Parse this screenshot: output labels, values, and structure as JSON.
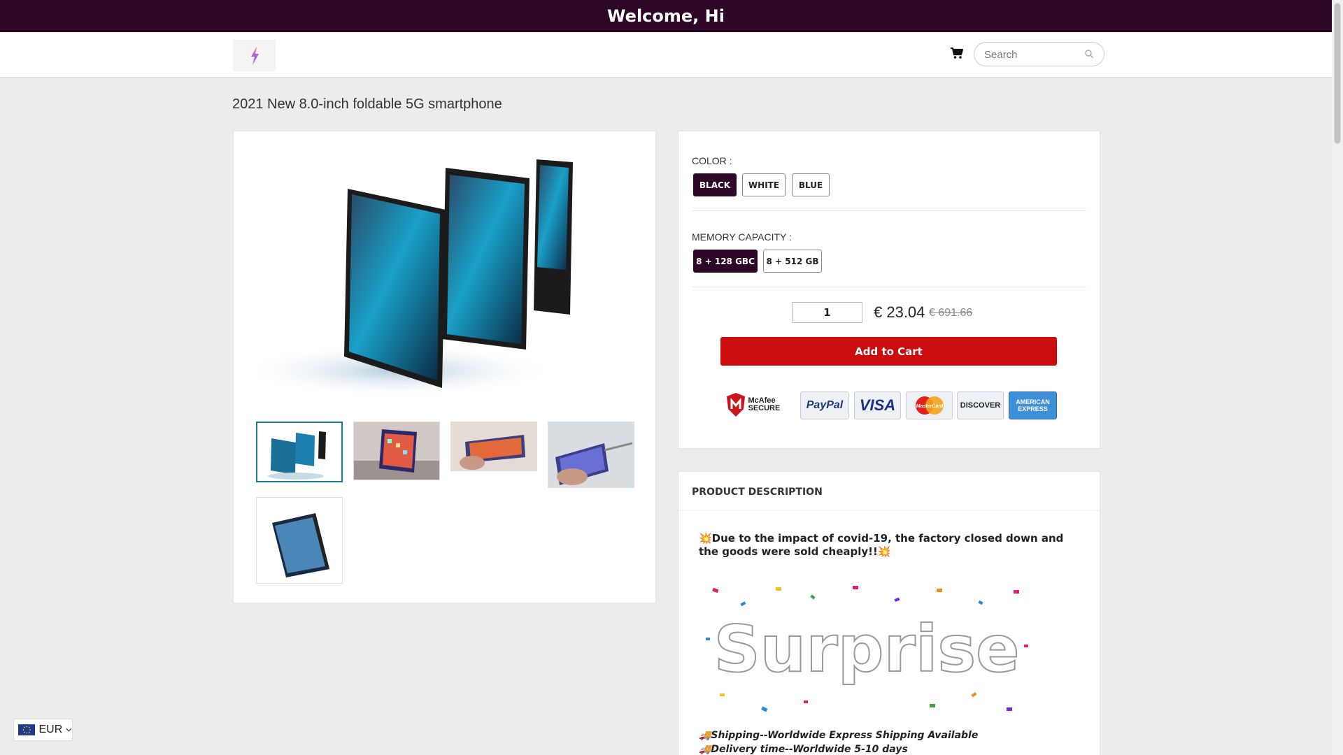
{
  "topbar": {
    "welcome": "Welcome, Hi"
  },
  "header": {
    "search_placeholder": "Search"
  },
  "product": {
    "title": "2021 New 8.0-inch foldable 5G smartphone",
    "color_label": "COLOR :",
    "colors": [
      "BLACK",
      "WHITE",
      "BLUE"
    ],
    "selected_color": "BLACK",
    "memory_label": "MEMORY CAPACITY :",
    "memory_options": [
      "8 + 128 GBC",
      "8 + 512 GB"
    ],
    "selected_memory": "8 + 128 GBC",
    "quantity": "1",
    "price": "€ 23.04",
    "old_price": "€ 691.66",
    "add_to_cart": "Add to Cart"
  },
  "payment_badges": [
    "McAfee SECURE",
    "PayPal",
    "VISA",
    "MasterCard",
    "DISCOVER",
    "AMERICAN EXPRESS"
  ],
  "description": {
    "heading": "PRODUCT DESCRIPTION",
    "intro": "💥Due to the impact of covid-19, the factory closed down and the goods were sold cheaply!!💥",
    "banner_text": "Surprise",
    "shipping": "🚚Shipping--Worldwide Express Shipping Available",
    "delivery": "🚚Delivery time--Worldwide 5-10 days"
  },
  "currency": {
    "code": "EUR"
  },
  "colors": {
    "brand": "#2e0628",
    "cart_button": "#cc0d0d",
    "thumb_active": "#1a7f8a"
  }
}
